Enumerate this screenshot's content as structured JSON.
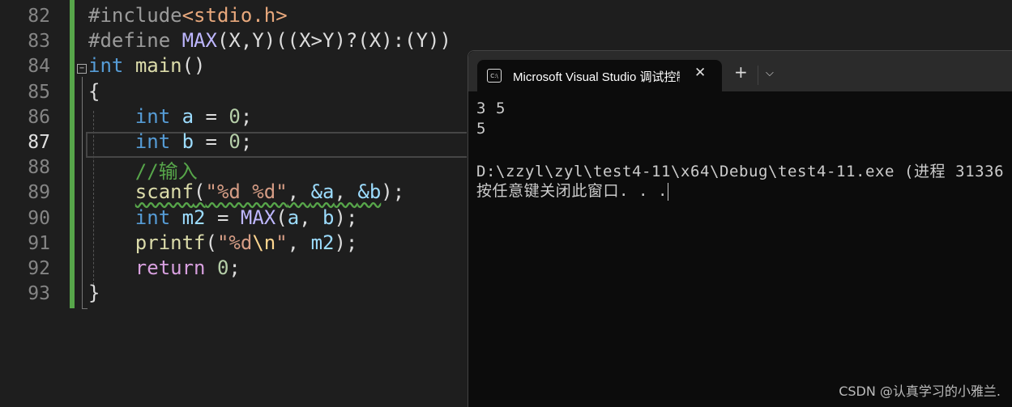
{
  "editor": {
    "current_line": 87,
    "lines": [
      {
        "n": 82,
        "tokens": [
          [
            "#include",
            "pp"
          ],
          [
            "<stdio.h>",
            "inc"
          ]
        ]
      },
      {
        "n": 83,
        "tokens": [
          [
            "#define ",
            "pp"
          ],
          [
            "MAX",
            "mac"
          ],
          [
            "(X,Y)((X>Y)?(X):(Y))",
            "pl"
          ]
        ]
      },
      {
        "n": 84,
        "tokens": [
          [
            "int",
            "kw"
          ],
          [
            " ",
            "pl"
          ],
          [
            "main",
            "fn"
          ],
          [
            "()",
            "pl"
          ]
        ]
      },
      {
        "n": 85,
        "tokens": [
          [
            "{",
            "pl"
          ]
        ]
      },
      {
        "n": 86,
        "tokens": [
          [
            "    ",
            "pl"
          ],
          [
            "int",
            "kw"
          ],
          [
            " ",
            "pl"
          ],
          [
            "a",
            "var"
          ],
          [
            " = ",
            "pl"
          ],
          [
            "0",
            "num"
          ],
          [
            ";",
            "pl"
          ]
        ]
      },
      {
        "n": 87,
        "tokens": [
          [
            "    ",
            "pl"
          ],
          [
            "int",
            "kw"
          ],
          [
            " ",
            "pl"
          ],
          [
            "b",
            "var"
          ],
          [
            " = ",
            "pl"
          ],
          [
            "0",
            "num"
          ],
          [
            ";",
            "pl"
          ]
        ]
      },
      {
        "n": 88,
        "tokens": [
          [
            "    ",
            "pl"
          ],
          [
            "//输入",
            "cm"
          ]
        ]
      },
      {
        "n": 89,
        "tokens": [
          [
            "    ",
            "pl"
          ],
          [
            "scanf",
            "fn squig"
          ],
          [
            "(",
            "pl squig"
          ],
          [
            "\"%d %d\"",
            "str squig"
          ],
          [
            ", ",
            "pl squig"
          ],
          [
            "&a",
            "var squig"
          ],
          [
            ", ",
            "pl squig"
          ],
          [
            "&b",
            "var squig"
          ],
          [
            ");",
            "pl"
          ]
        ]
      },
      {
        "n": 90,
        "tokens": [
          [
            "    ",
            "pl"
          ],
          [
            "int",
            "kw"
          ],
          [
            " ",
            "pl"
          ],
          [
            "m2",
            "var"
          ],
          [
            " = ",
            "pl"
          ],
          [
            "MAX",
            "mac"
          ],
          [
            "(",
            "pl"
          ],
          [
            "a",
            "var"
          ],
          [
            ", ",
            "pl"
          ],
          [
            "b",
            "var"
          ],
          [
            ");",
            "pl"
          ]
        ]
      },
      {
        "n": 91,
        "tokens": [
          [
            "    ",
            "pl"
          ],
          [
            "printf",
            "fn"
          ],
          [
            "(",
            "pl"
          ],
          [
            "\"%d",
            "str"
          ],
          [
            "\\n",
            "esc"
          ],
          [
            "\"",
            "str"
          ],
          [
            ", ",
            "pl"
          ],
          [
            "m2",
            "var"
          ],
          [
            ");",
            "pl"
          ]
        ]
      },
      {
        "n": 92,
        "tokens": [
          [
            "    ",
            "pl"
          ],
          [
            "return",
            "ret"
          ],
          [
            " ",
            "pl"
          ],
          [
            "0",
            "num"
          ],
          [
            ";",
            "pl"
          ]
        ]
      },
      {
        "n": 93,
        "tokens": [
          [
            "}",
            "pl"
          ]
        ]
      }
    ]
  },
  "terminal": {
    "tab_title": "Microsoft Visual Studio 调试控制台",
    "tab_icon": "console-icon",
    "new_tab_label": "+",
    "output": [
      "3 5",
      "5",
      "",
      "D:\\zzyl\\zyl\\test4-11\\x64\\Debug\\test4-11.exe (进程 31336",
      "按任意键关闭此窗口. . ."
    ]
  },
  "watermark": "CSDN @认真学习的小雅兰."
}
